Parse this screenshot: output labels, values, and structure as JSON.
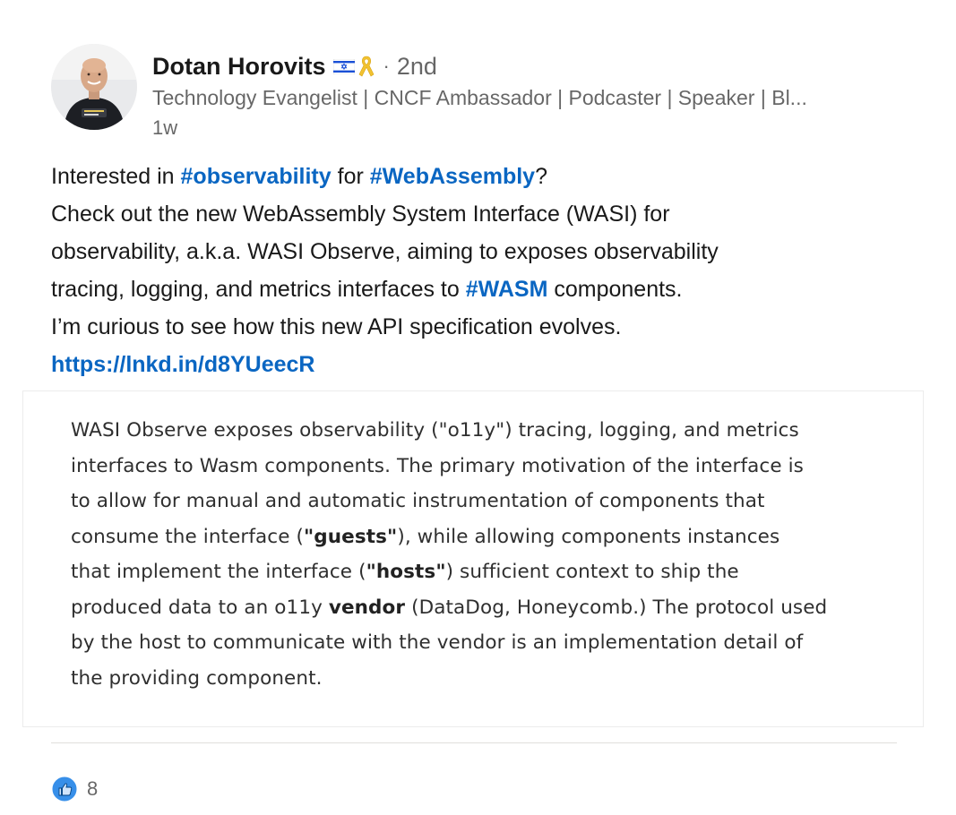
{
  "author": {
    "name": "Dotan Horovits",
    "flag_emoji": "🇮🇱",
    "ribbon_emoji": "🎗️",
    "separator": "·",
    "degree": "2nd",
    "headline": "Technology Evangelist | CNCF Ambassador | Podcaster | Speaker | Bl...",
    "time": "1w",
    "avatar_icon": "profile-photo"
  },
  "post": {
    "l1_a": "Interested in ",
    "l1_tag1": "#observability",
    "l1_b": " for ",
    "l1_tag2": "#WebAssembly",
    "l1_c": "?",
    "l2": "Check out the new WebAssembly System Interface (WASI) for",
    "l3": "observability, a.k.a. WASI Observe, aiming to exposes observability",
    "l4_a": "tracing, logging, and metrics interfaces to ",
    "l4_tag": "#WASM",
    "l4_b": " components.",
    "l5": "I’m curious to see how this new API specification evolves.",
    "link": "https://lnkd.in/d8YUeecR"
  },
  "media": {
    "l1": "WASI Observe exposes observability (\"o11y\") tracing, logging, and metrics",
    "l2": "interfaces to Wasm components. The primary motivation of the interface is",
    "l3": "to allow for manual and automatic instrumentation of components that",
    "l4_a": "consume the interface (",
    "l4_b": "\"guests\"",
    "l4_c": "), while allowing components instances",
    "l5_a": "that implement the interface (",
    "l5_b": "\"hosts\"",
    "l5_c": ") sufficient context to ship the",
    "l6_a": "produced data to an o11y ",
    "l6_b": "vendor",
    "l6_c": " (DataDog, Honeycomb.) The protocol used",
    "l7": "by the host to communicate with the vendor is an implementation detail of",
    "l8": "the providing component."
  },
  "social": {
    "reaction_icon": "like-icon",
    "count": "8"
  },
  "colors": {
    "link": "#0a66c2",
    "secondary_text": "rgba(0,0,0,0.6)",
    "like_blue": "#378fe9"
  }
}
